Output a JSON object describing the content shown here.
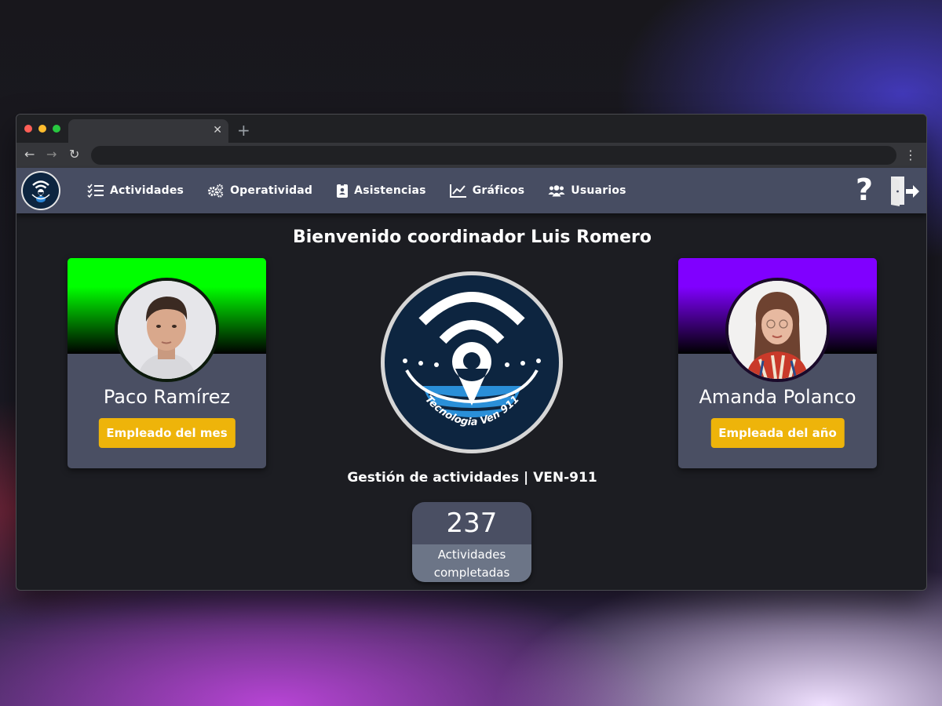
{
  "colors": {
    "accent": "#eeb40a",
    "nav_bg": "#474d62",
    "card_top_left": "#00ff00",
    "card_top_right": "#8000ff"
  },
  "nav": {
    "items": [
      {
        "label": "Actividades",
        "icon": "checklist-icon"
      },
      {
        "label": "Operatividad",
        "icon": "gears-icon"
      },
      {
        "label": "Asistencias",
        "icon": "id-badge-icon"
      },
      {
        "label": "Gráficos",
        "icon": "line-chart-icon"
      },
      {
        "label": "Usuarios",
        "icon": "users-icon"
      }
    ],
    "help_label": "?"
  },
  "welcome": "Bienvenido coordinador Luis Romero",
  "employee_month": {
    "name": "Paco Ramírez",
    "badge": "Empleado del mes"
  },
  "employee_year": {
    "name": "Amanda Polanco",
    "badge": "Empleada del año"
  },
  "logo_text": "Tecnologia Ven 911",
  "subtitle": "Gestión de actividades | VEN-911",
  "counter": {
    "value": "237",
    "label_line1": "Actividades",
    "label_line2": "completadas"
  }
}
